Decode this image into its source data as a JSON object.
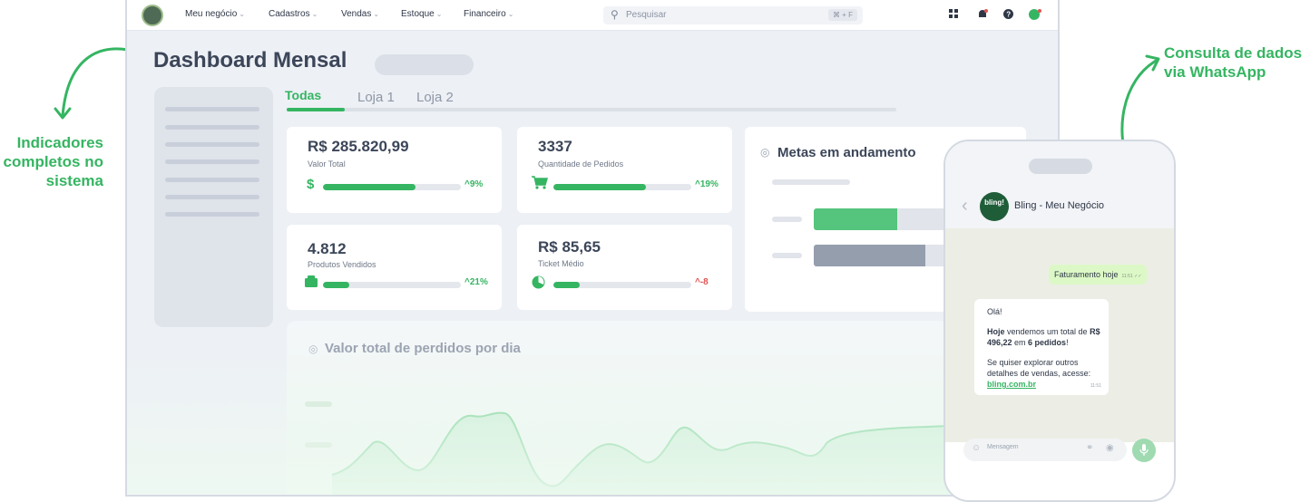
{
  "annotations": {
    "left": [
      "Indicadores",
      "completos no",
      "sistema"
    ],
    "right": [
      "Consulta de dados",
      "via WhatsApp"
    ]
  },
  "topbar": {
    "menu": [
      "Meu negócio",
      "Cadastros",
      "Vendas",
      "Estoque",
      "Financeiro"
    ],
    "chevron": "⌄",
    "search_placeholder": "Pesquisar",
    "search_shortcut": "⌘ + F"
  },
  "page": {
    "title": "Dashboard Mensal",
    "tabs": [
      "Todas",
      "Loja 1",
      "Loja 2"
    ]
  },
  "cards": [
    {
      "value": "R$ 285.820,99",
      "label": "Valor Total",
      "icon": "dollar-icon",
      "glyph": "$",
      "progress": 0.67,
      "change": "9%",
      "trend": "up",
      "arrow": "^"
    },
    {
      "value": "3337",
      "label": "Quantidade de Pedidos",
      "icon": "cart-icon",
      "glyph": "🛒",
      "progress": 0.67,
      "change": "19%",
      "trend": "up",
      "arrow": "^"
    },
    {
      "value": "4.812",
      "label": "Produtos Vendidos",
      "icon": "box-icon",
      "glyph": "▦",
      "progress": 0.19,
      "change": "21%",
      "trend": "up",
      "arrow": "^"
    },
    {
      "value": "R$ 85,65",
      "label": "Ticket Médio",
      "icon": "pie-chart-icon",
      "glyph": "◔",
      "progress": 0.19,
      "change": "-8",
      "trend": "down",
      "arrow": "^"
    }
  ],
  "metas": {
    "title": "Metas em andamento",
    "icon_glyph": "◎"
  },
  "daily_chart": {
    "title": "Valor total de perdidos por dia",
    "icon_glyph": "◎"
  },
  "whatsapp": {
    "contact": "Bling - Meu Negócio",
    "logo_text": "bling!",
    "back_glyph": "‹",
    "outgoing": {
      "text": "Faturamento hoje",
      "time": "11:51 ✓✓"
    },
    "incoming": {
      "greeting": "Olá!",
      "line_bold1": "Hoje",
      "line_mid": " vendemos um total de ",
      "amount": "R$ 496,22",
      "line_em": " em ",
      "orders": "6 pedidos",
      "line_end": "!",
      "explore": "Se quiser explorar outros detalhes de vendas, acesse:",
      "link": "bling.com.br",
      "time": "11:51"
    },
    "input_placeholder": "Mensagem",
    "mic_glyph": "🎤"
  }
}
